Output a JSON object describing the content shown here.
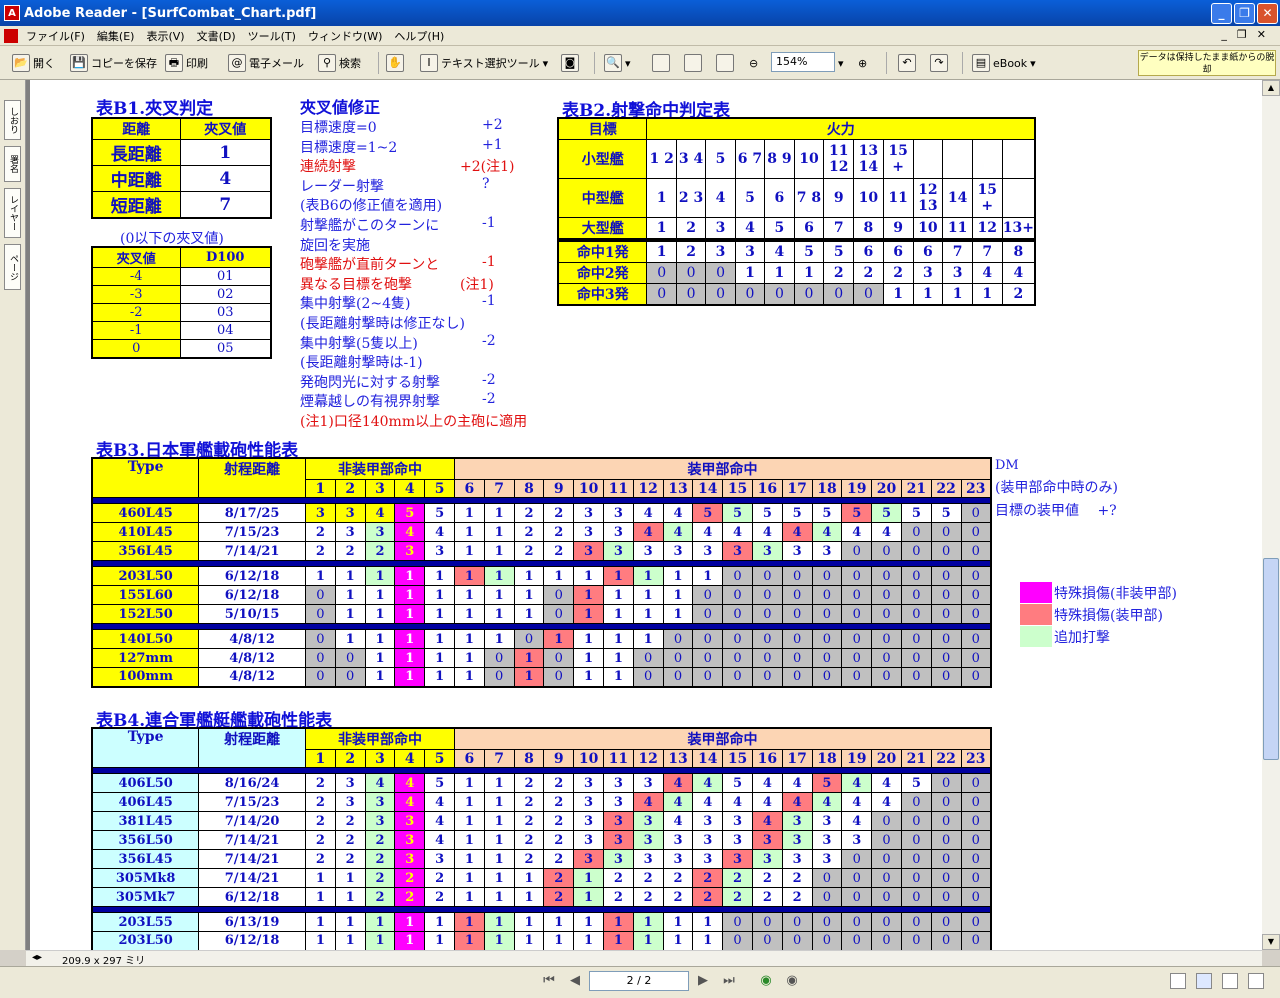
{
  "window": {
    "title": "Adobe Reader - [SurfCombat_Chart.pdf]"
  },
  "menu": [
    "ファイル(F)",
    "編集(E)",
    "表示(V)",
    "文書(D)",
    "ツール(T)",
    "ウィンドウ(W)",
    "ヘルプ(H)"
  ],
  "toolbar": {
    "open": "開く",
    "save_copy": "コピーを保存",
    "print": "印刷",
    "email": "電子メール",
    "search": "検索",
    "text_select": "テキスト選択ツール",
    "zoom": "154%",
    "ebook": "eBook",
    "notice": "データは保持したまま紙からの脱却"
  },
  "sidetabs": [
    "しおり",
    "署名",
    "レイヤー",
    "ページ"
  ],
  "status": {
    "page_size": "209.9 x 297 ミリ",
    "page_indicator": "2 / 2"
  },
  "b1": {
    "title": "表B1.夾叉判定",
    "hdr": [
      "距離",
      "夾叉値"
    ],
    "rows": [
      [
        "長距離",
        "1"
      ],
      [
        "中距離",
        "4"
      ],
      [
        "短距離",
        "7"
      ]
    ],
    "sub": "(0以下の夾叉値)",
    "hdr2": [
      "夾叉値",
      "D100"
    ],
    "rows2": [
      [
        "-4",
        "01"
      ],
      [
        "-3",
        "02"
      ],
      [
        "-2",
        "03"
      ],
      [
        "-1",
        "04"
      ],
      [
        "0",
        "05"
      ]
    ]
  },
  "mods": {
    "title": "夾叉値修正",
    "lines": [
      {
        "t": "目標速度=0",
        "v": "+2",
        "c": "blue"
      },
      {
        "t": "目標速度=1~2",
        "v": "+1",
        "c": "blue"
      },
      {
        "t": "連続射撃",
        "v": "+2(注1)",
        "c": "red"
      },
      {
        "t": "レーダー射撃",
        "v": "?",
        "c": "blue"
      },
      {
        "t": "(表B6の修正値を適用)",
        "v": "",
        "c": "blue"
      },
      {
        "t": "射撃艦がこのターンに",
        "v": "-1",
        "c": "blue"
      },
      {
        "t": "旋回を実施",
        "v": "",
        "c": "blue"
      },
      {
        "t": "砲撃艦が直前ターンと",
        "v": "-1",
        "c": "red"
      },
      {
        "t": "異なる目標を砲撃",
        "v": "(注1)",
        "c": "red"
      },
      {
        "t": "集中射撃(2~4隻)",
        "v": "-1",
        "c": "blue"
      },
      {
        "t": "(長距離射撃時は修正なし)",
        "v": "",
        "c": "blue"
      },
      {
        "t": "集中射撃(5隻以上)",
        "v": "-2",
        "c": "blue"
      },
      {
        "t": "(長距離射撃時は-1)",
        "v": "",
        "c": "blue"
      },
      {
        "t": "発砲閃光に対する射撃",
        "v": "-2",
        "c": "blue"
      },
      {
        "t": "煙幕越しの有視界射撃",
        "v": "-2",
        "c": "blue"
      },
      {
        "t": "(注1)口径140mm以上の主砲に適用",
        "v": "",
        "c": "red"
      }
    ]
  },
  "b2": {
    "title": "表B2.射撃命中判定表",
    "hdr": [
      "目標",
      "火力"
    ],
    "rows": [
      {
        "label": "小型艦",
        "cells": [
          "1 2",
          "3 4",
          "5",
          "6 7",
          "8 9",
          "10",
          "11 12",
          "13 14",
          "15 +",
          "",
          "",
          "",
          ""
        ]
      },
      {
        "label": "中型艦",
        "cells": [
          "1",
          "2 3",
          "4",
          "5",
          "6",
          "7 8",
          "9",
          "10",
          "11",
          "12 13",
          "14",
          "15 +",
          ""
        ]
      },
      {
        "label": "大型艦",
        "cells": [
          "1",
          "2",
          "3",
          "4",
          "5",
          "6",
          "7",
          "8",
          "9",
          "10",
          "11",
          "12",
          "13+"
        ]
      }
    ],
    "hits": [
      {
        "label": "命中1発",
        "cells": [
          "1",
          "2",
          "3",
          "3",
          "4",
          "5",
          "5",
          "6",
          "6",
          "6",
          "7",
          "7",
          "8"
        ]
      },
      {
        "label": "命中2発",
        "cells": [
          "0",
          "0",
          "0",
          "1",
          "1",
          "1",
          "2",
          "2",
          "2",
          "3",
          "3",
          "4",
          "4"
        ]
      },
      {
        "label": "命中3発",
        "cells": [
          "0",
          "0",
          "0",
          "0",
          "0",
          "0",
          "0",
          "0",
          "1",
          "1",
          "1",
          "1",
          "2"
        ]
      }
    ]
  },
  "b3": {
    "title": "表B3.日本軍艦載砲性能表",
    "hdr": {
      "type": "Type",
      "range": "射程距離",
      "unarmored": "非装甲部命中",
      "armored": "装甲部命中",
      "cols": [
        "1",
        "2",
        "3",
        "4",
        "5",
        "6",
        "7",
        "8",
        "9",
        "10",
        "11",
        "12",
        "13",
        "14",
        "15",
        "16",
        "17",
        "18",
        "19",
        "20",
        "21",
        "22",
        "23"
      ]
    },
    "dm": [
      "DM",
      "(装甲部命中時のみ)",
      "目標の装甲値　 +?"
    ],
    "groups": [
      [
        [
          "460L45",
          "8/17/25",
          "3,3,4,5,5,1,1,2,2,3,3,4,4,5,5,5,5,5,5,5,5,5,0",
          "y,y,y,mag,w,w,w,w,w,w,w,w,w,rd,gr,w,w,w,rd,gr,w,w,gy"
        ],
        [
          "410L45",
          "7/15/23",
          "2,3,3,4,4,1,1,2,2,3,3,4,4,4,4,4,4,4,4,4,0,0,0",
          "w,w,gr,mag,w,w,w,w,w,w,w,rd,gr,w,w,w,rd,gr,w,w,gy,gy,gy"
        ],
        [
          "356L45",
          "7/14/21",
          "2,2,2,3,3,1,1,2,2,3,3,3,3,3,3,3,3,3,0,0,0,0,0",
          "w,w,gr,mag,w,w,w,w,w,rd,gr,w,w,w,rd,gr,w,w,gy,gy,gy,gy,gy"
        ]
      ],
      [
        [
          "203L50",
          "6/12/18",
          "1,1,1,1,1,1,1,1,1,1,1,1,1,1,0,0,0,0,0,0,0,0,0",
          "w,w,gr,pk,w,rd,gr,w,w,w,rd,gr,w,w,gy,gy,gy,gy,gy,gy,gy,gy,gy"
        ],
        [
          "155L60",
          "6/12/18",
          "0,1,1,1,1,1,1,1,0,1,1,1,1,0,0,0,0,0,0,0,0,0,0",
          "gy,w,w,pk,w,w,w,w,gy,rd,w,w,w,gy,gy,gy,gy,gy,gy,gy,gy,gy,gy"
        ],
        [
          "152L50",
          "5/10/15",
          "0,1,1,1,1,1,1,1,0,1,1,1,1,0,0,0,0,0,0,0,0,0,0",
          "gy,w,w,pk,w,w,w,w,gy,rd,w,w,w,gy,gy,gy,gy,gy,gy,gy,gy,gy,gy"
        ]
      ],
      [
        [
          "140L50",
          "4/8/12",
          "0,1,1,1,1,1,1,0,1,1,1,1,0,0,0,0,0,0,0,0,0,0,0",
          "gy,w,w,pk,w,w,w,gy,rd,w,w,w,gy,gy,gy,gy,gy,gy,gy,gy,gy,gy,gy"
        ],
        [
          "127mm",
          "4/8/12",
          "0,0,1,1,1,1,0,1,0,1,1,0,0,0,0,0,0,0,0,0,0,0,0",
          "gy,gy,w,pk,w,w,gy,rd,gy,w,w,gy,gy,gy,gy,gy,gy,gy,gy,gy,gy,gy,gy"
        ],
        [
          "100mm",
          "4/8/12",
          "0,0,1,1,1,1,0,1,0,1,1,0,0,0,0,0,0,0,0,0,0,0,0",
          "gy,gy,w,pk,w,w,gy,rd,gy,w,w,gy,gy,gy,gy,gy,gy,gy,gy,gy,gy,gy,gy"
        ]
      ]
    ]
  },
  "legend": [
    {
      "label": "特殊損傷(非装甲部)",
      "color": "#ff00ff"
    },
    {
      "label": "特殊損傷(装甲部)",
      "color": "#ff7c80"
    },
    {
      "label": "追加打撃",
      "color": "#ccffcc"
    }
  ],
  "b4": {
    "title": "表B4.連合軍艦艇艦載砲性能表",
    "hdr": {
      "type": "Type",
      "range": "射程距離",
      "unarmored": "非装甲部命中",
      "armored": "装甲部命中",
      "cols": [
        "1",
        "2",
        "3",
        "4",
        "5",
        "6",
        "7",
        "8",
        "9",
        "10",
        "11",
        "12",
        "13",
        "14",
        "15",
        "16",
        "17",
        "18",
        "19",
        "20",
        "21",
        "22",
        "23"
      ]
    },
    "groups": [
      [
        [
          "406L50",
          "8/16/24",
          "2,3,4,4,5,1,1,2,2,3,3,3,4,4,5,4,4,5,4,4,5,0,0",
          "w,w,gr,mag,w,w,w,w,w,w,w,w,rd,gr,w,w,w,rd,gr,w,w,gy,gy"
        ],
        [
          "406L45",
          "7/15/23",
          "2,3,3,4,4,1,1,2,2,3,3,4,4,4,4,4,4,4,4,4,0,0,0",
          "w,w,gr,mag,w,w,w,w,w,w,w,rd,gr,w,w,w,rd,gr,w,w,gy,gy,gy"
        ],
        [
          "381L45",
          "7/14/20",
          "2,2,3,3,4,1,1,2,2,3,3,3,4,3,3,4,3,3,4,0,0,0,0",
          "w,w,gr,mag,w,w,w,w,w,w,rd,gr,w,w,w,rd,gr,w,w,gy,gy,gy,gy"
        ],
        [
          "356L50",
          "7/14/21",
          "2,2,2,3,4,1,1,2,2,3,3,3,3,3,3,3,3,3,3,0,0,0,0",
          "w,w,gr,mag,w,w,w,w,w,w,rd,gr,w,w,w,rd,gr,w,w,gy,gy,gy,gy"
        ],
        [
          "356L45",
          "7/14/21",
          "2,2,2,3,3,1,1,2,2,3,3,3,3,3,3,3,3,3,0,0,0,0,0",
          "w,w,gr,mag,w,w,w,w,w,rd,gr,w,w,w,rd,gr,w,w,gy,gy,gy,gy,gy"
        ],
        [
          "305Mk8",
          "7/14/21",
          "1,1,2,2,2,1,1,1,2,1,2,2,2,2,2,2,2,0,0,0,0,0,0",
          "w,w,gr,mag,w,w,w,w,rd,gr,w,w,w,rd,gr,w,w,gy,gy,gy,gy,gy,gy"
        ],
        [
          "305Mk7",
          "6/12/18",
          "1,1,2,2,2,1,1,1,2,1,2,2,2,2,2,2,2,0,0,0,0,0,0",
          "w,w,gr,mag,w,w,w,w,rd,gr,w,w,w,rd,gr,w,w,gy,gy,gy,gy,gy,gy"
        ]
      ],
      [
        [
          "203L55",
          "6/13/19",
          "1,1,1,1,1,1,1,1,1,1,1,1,1,1,0,0,0,0,0,0,0,0,0",
          "w,w,gr,pk,w,rd,gr,w,w,w,rd,gr,w,w,gy,gy,gy,gy,gy,gy,gy,gy,gy"
        ],
        [
          "203L50",
          "6/12/18",
          "1,1,1,1,1,1,1,1,1,1,1,1,1,1,0,0,0,0,0,0,0,0,0",
          "w,w,gr,pk,w,rd,gr,w,w,w,rd,gr,w,w,gy,gy,gy,gy,gy,gy,gy,gy,gy"
        ]
      ]
    ]
  }
}
